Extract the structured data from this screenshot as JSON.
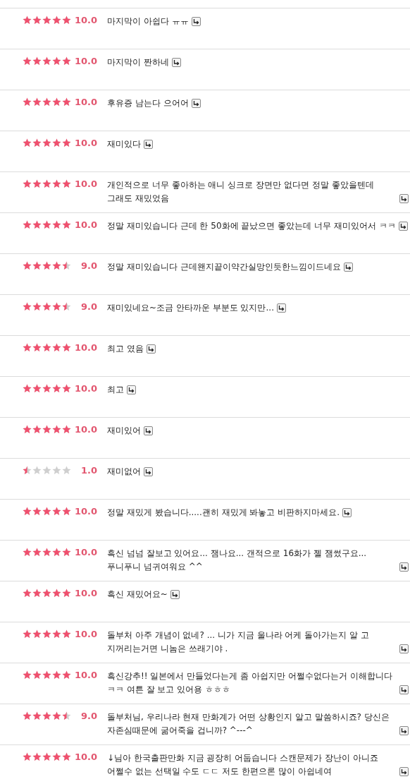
{
  "reviews": [
    {
      "stars": 5,
      "score": "10.0",
      "comment": "마지막이 아쉽다 ㅠㅠ"
    },
    {
      "stars": 5,
      "score": "10.0",
      "comment": "마지막이 짠하네"
    },
    {
      "stars": 5,
      "score": "10.0",
      "comment": "후유증 남는다 으어어"
    },
    {
      "stars": 5,
      "score": "10.0",
      "comment": "재미있다"
    },
    {
      "stars": 5,
      "score": "10.0",
      "comment": "개인적으로 너무 좋아하는 애니 싱크로 장면만 없다면 정말 좋았을텐데 그래도 재밌었음"
    },
    {
      "stars": 5,
      "score": "10.0",
      "comment": "정말 재미있습니다 근데 한 50화에 끝났으면 좋았는데 너무 재미있어서 ㅋㅋ"
    },
    {
      "stars": 4.5,
      "score": "9.0",
      "comment": "정말 재미있습니다 근데왠지끝이약간실망인듯한느낌이드네요"
    },
    {
      "stars": 4.5,
      "score": "9.0",
      "comment": "재미있네요~조금 안타까운 부분도 있지만..."
    },
    {
      "stars": 5,
      "score": "10.0",
      "comment": "최고 였음"
    },
    {
      "stars": 5,
      "score": "10.0",
      "comment": "최고"
    },
    {
      "stars": 5,
      "score": "10.0",
      "comment": "재미있어"
    },
    {
      "stars": 0.5,
      "score": "1.0",
      "comment": "재미없어"
    },
    {
      "stars": 5,
      "score": "10.0",
      "comment": "정말 재밌게 봤습니다.....괜히 재밌게 봐놓고 비판하지마세요."
    },
    {
      "stars": 5,
      "score": "10.0",
      "comment": "흑신 넘넘 잘보고 있어요... 잼나요... 갠적으로 16화가 젤 잼썼구요... 푸니푸니 넘귀여워요 ^^"
    },
    {
      "stars": 5,
      "score": "10.0",
      "comment": "흑신 재밌어요~"
    },
    {
      "stars": 5,
      "score": "10.0",
      "comment": "돌부처 아주 개념이 없네? ... 니가 지금 울나라 어케 돌아가는지 알 고 지꺼리는거면 니놈은 쓰래기야 ."
    },
    {
      "stars": 5,
      "score": "10.0",
      "comment": "흑신강추!! 일본에서 만들었다는게 좀 아쉽지만 어쩔수없다는거 이해합니다 ㅋㅋ 여튼 잘 보고 있어용 ㅎㅎㅎ"
    },
    {
      "stars": 4.5,
      "score": "9.0",
      "comment": "돌부처님, 우리나라 현재 만화계가 어떤 상황인지 알고 말씀하시죠? 당신은 자존심때문에 굶어죽을 겁니까? ^---^"
    },
    {
      "stars": 5,
      "score": "10.0",
      "comment": "↓님아 한국출판만화 지금 굉장히 어둡습니다 스캔문제가 장난이 아니죠 어쩔수 없는 선택일 수도 ㄷㄷ 저도 한편으론 많이 아쉽네여"
    }
  ]
}
